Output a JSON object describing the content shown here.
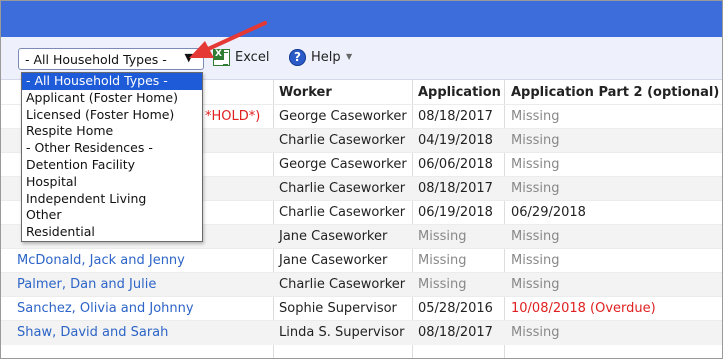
{
  "toolbar": {
    "household_type_selected": "- All Household Types -",
    "excel_label": "Excel",
    "help_label": "Help"
  },
  "dropdown_options": [
    "- All Household Types -",
    "Applicant (Foster Home)",
    "Licensed (Foster Home)",
    "Respite Home",
    "- Other Residences -",
    "Detention Facility",
    "Hospital",
    "Independent Living",
    "Other",
    "Residential"
  ],
  "table": {
    "headers": [
      "",
      "Worker",
      "Application",
      "Application Part 2 (optional)"
    ],
    "hold_tag": "*HOLD*)",
    "rows": [
      {
        "household": "",
        "worker": "George Caseworker",
        "application": "08/18/2017",
        "part2": "Missing"
      },
      {
        "household": "",
        "worker": "Charlie Caseworker",
        "application": "04/19/2018",
        "part2": "Missing"
      },
      {
        "household": "",
        "worker": "George Caseworker",
        "application": "06/06/2018",
        "part2": "Missing"
      },
      {
        "household": "",
        "worker": "Charlie Caseworker",
        "application": "08/18/2017",
        "part2": "Missing"
      },
      {
        "household": "",
        "worker": "Charlie Caseworker",
        "application": "06/19/2018",
        "part2": "06/29/2018"
      },
      {
        "household": "",
        "worker": "Jane Caseworker",
        "application": "Missing",
        "part2": "Missing"
      },
      {
        "household": "McDonald, Jack and Jenny",
        "worker": "Jane Caseworker",
        "application": "Missing",
        "part2": "Missing"
      },
      {
        "household": "Palmer, Dan and Julie",
        "worker": "Charlie Caseworker",
        "application": "Missing",
        "part2": "Missing"
      },
      {
        "household": "Sanchez, Olivia and Johnny",
        "worker": "Sophie Supervisor",
        "application": "05/28/2016",
        "part2": "10/08/2018 (Overdue)"
      },
      {
        "household": "Shaw, David and Sarah",
        "worker": "Linda S. Supervisor",
        "application": "08/18/2017",
        "part2": "Missing"
      }
    ]
  },
  "colors": {
    "topbar": "#3d6cdb",
    "link": "#2c64c7",
    "overdue": "#e02020",
    "missing": "#888888",
    "annotation_arrow": "#e53935"
  }
}
